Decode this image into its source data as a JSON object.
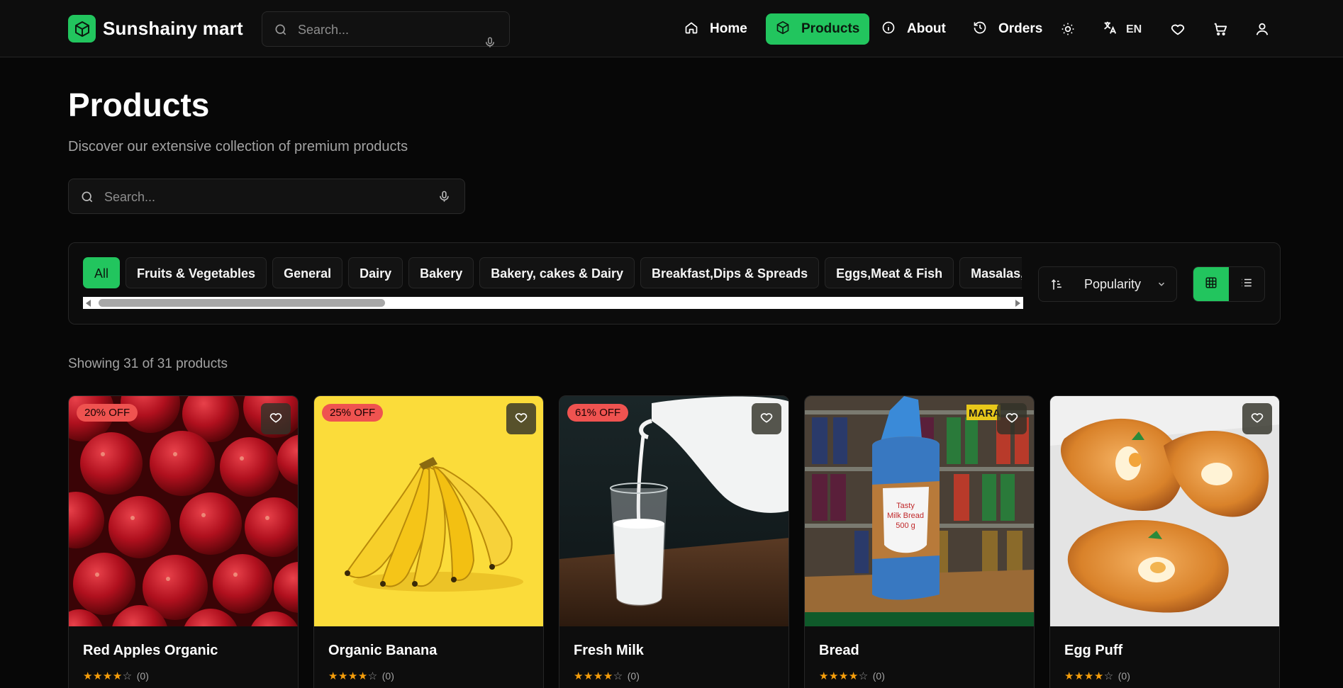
{
  "header": {
    "brand": "Sunshainy mart",
    "search_placeholder": "Search...",
    "nav": [
      {
        "label": "Home",
        "icon": "home-icon"
      },
      {
        "label": "Products",
        "icon": "box-icon",
        "active": true
      },
      {
        "label": "About",
        "icon": "info-icon"
      },
      {
        "label": "Orders",
        "icon": "history-icon"
      }
    ],
    "language": "EN"
  },
  "page": {
    "title": "Products",
    "subtitle": "Discover our extensive collection of premium products",
    "search_placeholder": "Search..."
  },
  "filters": {
    "categories": [
      "All",
      "Fruits & Vegetables",
      "General",
      "Dairy",
      "Bakery",
      "Bakery, cakes & Dairy",
      "Breakfast,Dips & Spreads",
      "Eggs,Meat & Fish",
      "Masalas, Oils & Dry Fruits"
    ],
    "selected_category": "All",
    "sort": "Popularity",
    "view": "grid"
  },
  "results": {
    "summary": "Showing 31 of 31 products"
  },
  "products": [
    {
      "name": "Red Apples Organic",
      "discount": "20% OFF",
      "rating": 4,
      "reviews": "(0)"
    },
    {
      "name": "Organic Banana",
      "discount": "25% OFF",
      "rating": 4,
      "reviews": "(0)"
    },
    {
      "name": "Fresh Milk",
      "discount": "61% OFF",
      "rating": 4,
      "reviews": "(0)"
    },
    {
      "name": "Bread",
      "discount": "",
      "rating": 4,
      "reviews": "(0)"
    },
    {
      "name": "Egg Puff",
      "discount": "",
      "rating": 4,
      "reviews": "(0)"
    }
  ],
  "product_image_text": {
    "bread_pack": [
      "Tasty",
      "Milk Bread",
      "500 g"
    ],
    "store_sign": "MARA"
  },
  "colors": {
    "accent": "#22c55e",
    "discount_badge": "#ef5350",
    "star": "#f59e0b",
    "background": "#070707"
  }
}
